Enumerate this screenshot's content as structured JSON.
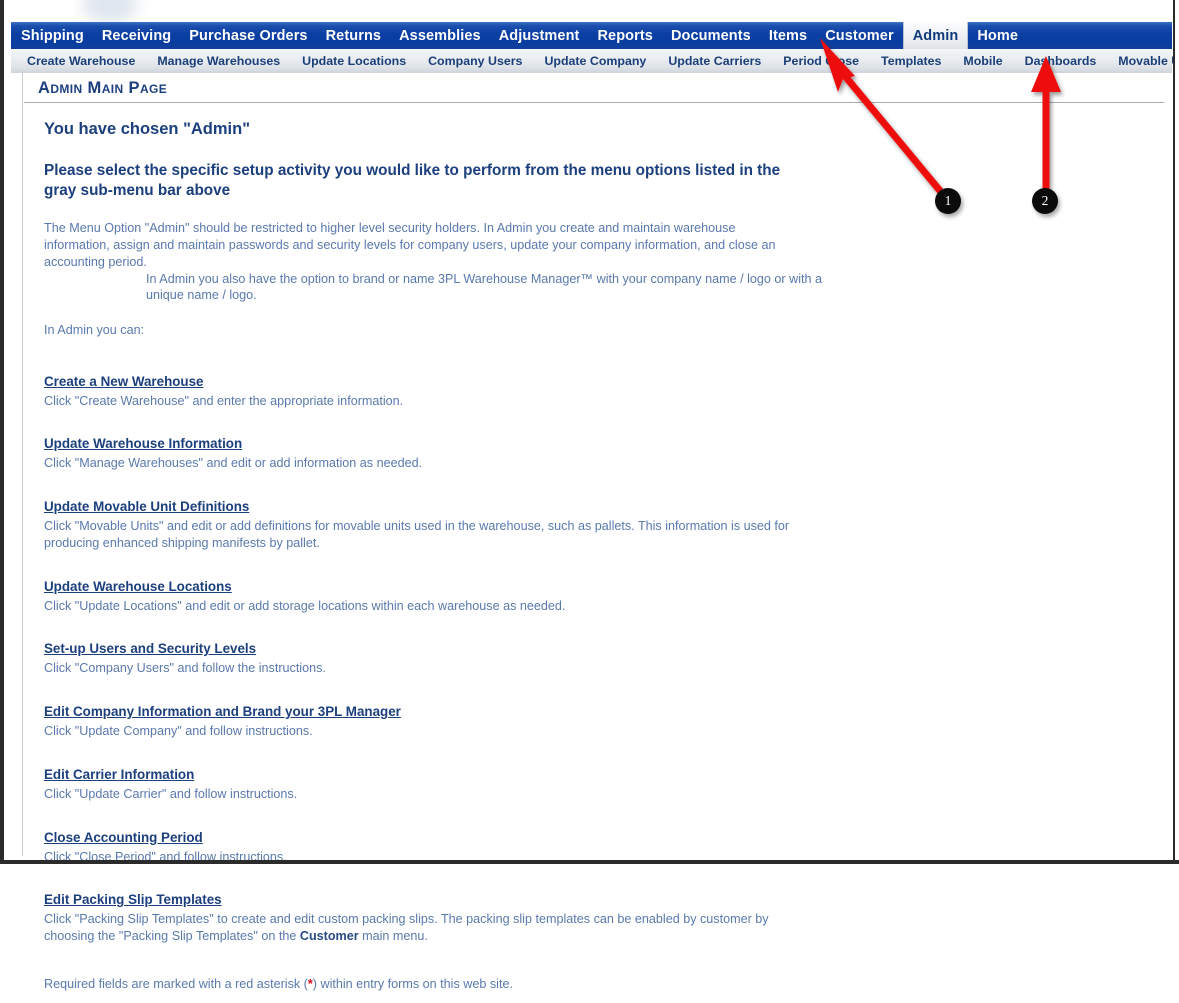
{
  "window": {
    "title_strip_blurred": true
  },
  "main_nav": {
    "items": [
      {
        "label": "Shipping",
        "selected": false
      },
      {
        "label": "Receiving",
        "selected": false
      },
      {
        "label": "Purchase Orders",
        "selected": false
      },
      {
        "label": "Returns",
        "selected": false
      },
      {
        "label": "Assemblies",
        "selected": false
      },
      {
        "label": "Adjustment",
        "selected": false
      },
      {
        "label": "Reports",
        "selected": false
      },
      {
        "label": "Documents",
        "selected": false
      },
      {
        "label": "Items",
        "selected": false
      },
      {
        "label": "Customer",
        "selected": false
      },
      {
        "label": "Admin",
        "selected": true
      },
      {
        "label": "Home",
        "selected": false
      }
    ],
    "background_color": "#0b3ea2",
    "text_color": "#ffffff",
    "selected_text_color": "#113a7a"
  },
  "sub_nav": {
    "items": [
      {
        "label": "Create Warehouse"
      },
      {
        "label": "Manage Warehouses"
      },
      {
        "label": "Update Locations"
      },
      {
        "label": "Company Users"
      },
      {
        "label": "Update Company"
      },
      {
        "label": "Update Carriers"
      },
      {
        "label": "Period Close"
      },
      {
        "label": "Templates"
      },
      {
        "label": "Mobile"
      },
      {
        "label": "Dashboards"
      },
      {
        "label": "Movable Units"
      }
    ],
    "text_color": "#1b3f79"
  },
  "page": {
    "title": "Admin Main Page",
    "heading": "You have chosen \"Admin\"",
    "subheading": "Please select the specific setup activity you would like to perform from the menu options listed in the gray sub-menu bar above",
    "intro_paragraph": "The Menu Option \"Admin\" should be restricted to higher level security holders. In Admin you create and maintain warehouse information, assign and maintain passwords and security levels for company users, update your company information, and close an accounting period.",
    "indented_paragraph": "In Admin you also have the option to brand or name 3PL Warehouse Manager™ with your company name / logo or with a unique name / logo.",
    "list_lead_in": "In Admin you can:",
    "footer_note_before": "Required fields are marked with a red asterisk (",
    "footer_asterisk": "*",
    "footer_note_after": ") within entry forms on this web site."
  },
  "links": [
    {
      "title": "Create a New Warehouse",
      "description": "Click \"Create Warehouse\" and enter the appropriate information."
    },
    {
      "title": "Update Warehouse Information",
      "description": "Click \"Manage Warehouses\" and edit or add information as needed."
    },
    {
      "title": "Update Movable Unit Definitions",
      "description": "Click \"Movable Units\" and edit or add definitions for movable units used in the warehouse, such as pallets. This information is used for producing enhanced shipping manifests by pallet."
    },
    {
      "title": "Update Warehouse Locations",
      "description": "Click \"Update Locations\" and edit or add storage locations within each warehouse as needed."
    },
    {
      "title": "Set-up Users and Security Levels",
      "description": "Click \"Company Users\" and follow the instructions."
    },
    {
      "title": "Edit Company Information and Brand your 3PL Manager",
      "description": "Click \"Update Company\" and follow instructions."
    },
    {
      "title": "Edit Carrier Information",
      "description": "Click \"Update Carrier\" and follow instructions."
    },
    {
      "title": "Close Accounting Period",
      "description": "Click \"Close Period\" and follow instructions."
    },
    {
      "title": "Edit Packing Slip Templates",
      "description_part1": "Click \"Packing Slip Templates\" to create and edit custom packing slips. The packing slip templates can be enabled by customer by choosing the \"Packing Slip Templates\" on the ",
      "description_bold": "Customer",
      "description_part2": " main menu."
    }
  ],
  "callouts": {
    "color": "#ee1111",
    "items": [
      {
        "number": "1",
        "points_to": "Admin"
      },
      {
        "number": "2",
        "points_to": "Movable Units"
      }
    ]
  }
}
